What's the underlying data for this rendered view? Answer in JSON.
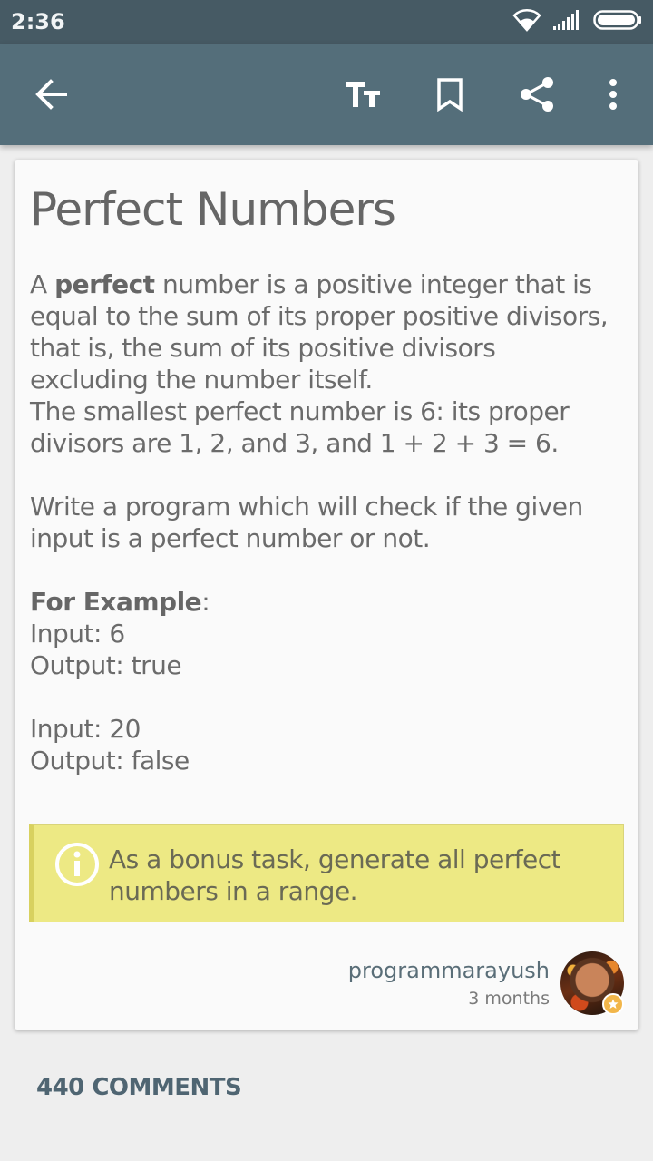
{
  "status_bar": {
    "time": "2:36",
    "icons": [
      "wifi-icon",
      "signal-icon",
      "battery-icon"
    ]
  },
  "toolbar": {
    "back_icon": "arrow-left-icon",
    "actions": [
      "text-size-icon",
      "bookmark-icon",
      "share-icon",
      "more-vert-icon"
    ],
    "background": "#546e7a"
  },
  "article": {
    "title": "Perfect Numbers",
    "para1_pre": "A ",
    "para1_bold": "perfect",
    "para1_post": " number is a positive integer that is equal to the sum of its proper positive divisors, that is, the sum of its positive divisors excluding the number itself.",
    "para2": "The smallest perfect number is 6: its proper divisors are 1, 2, and 3, and 1 + 2 + 3 = 6.",
    "para3": "Write a program which will check if the given input is a perfect number or not.",
    "example_heading": "For Example",
    "example_colon": ":",
    "example1_input": "Input: 6",
    "example1_output": "Output: true",
    "example2_input": "Input: 20",
    "example2_output": "Output: false",
    "callout_text": "As a bonus task, generate all perfect numbers in a range.",
    "callout_color": "#ede984"
  },
  "author": {
    "name": "programmarayush",
    "time": "3 months"
  },
  "comments": {
    "label": "440 COMMENTS"
  }
}
